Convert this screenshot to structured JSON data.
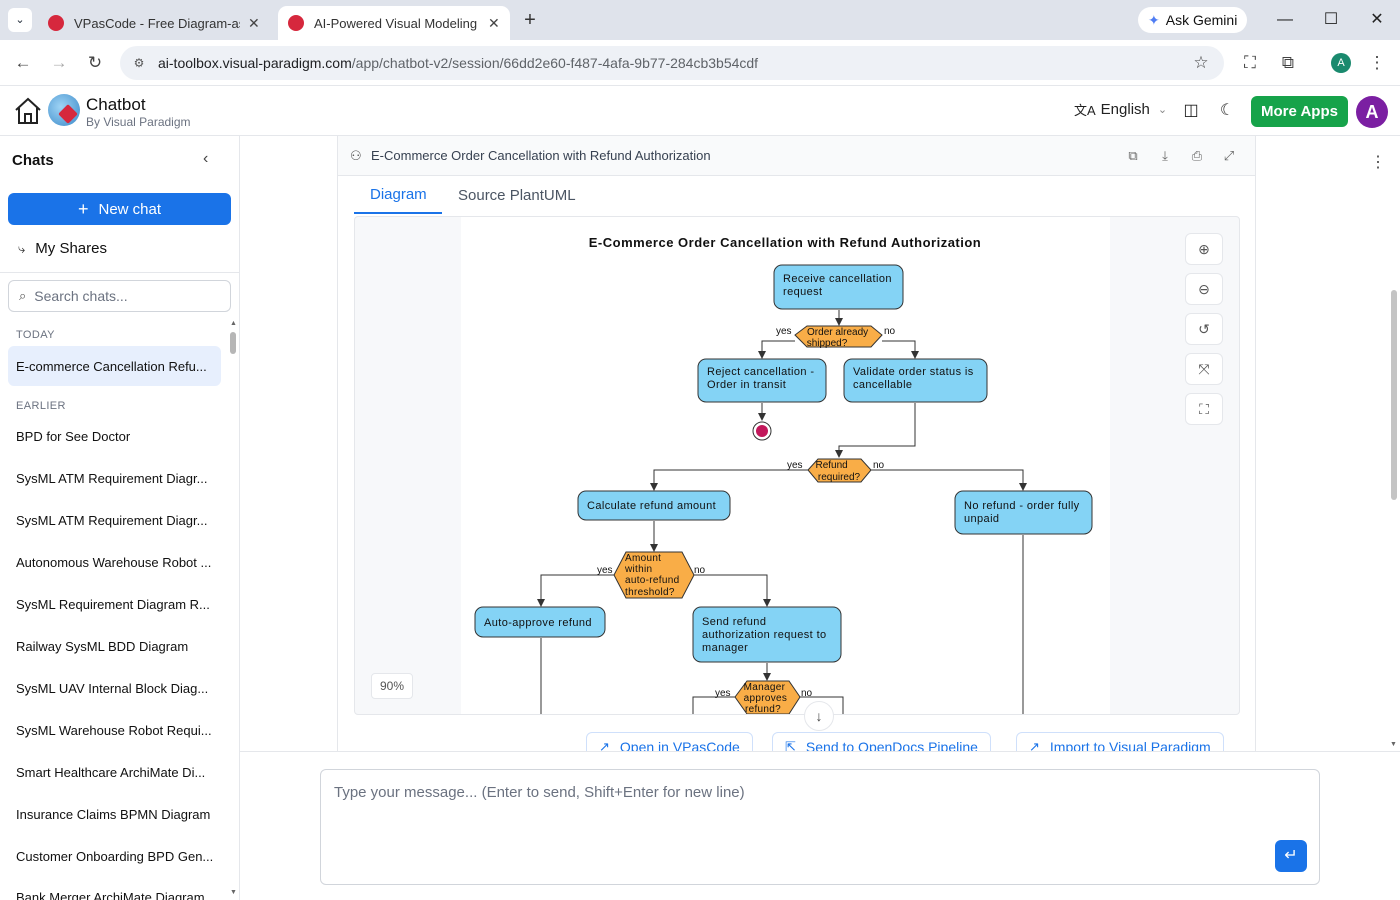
{
  "browser": {
    "tabs": [
      {
        "title": "VPasCode - Free Diagram-as-Code",
        "favicon_color": "#d6283d"
      },
      {
        "title": "AI-Powered Visual Modeling Chatbot",
        "favicon_color": "#d6283d"
      }
    ],
    "ask_gemini": "Ask Gemini",
    "url_host": "ai-toolbox.visual-paradigm.com",
    "url_path": "/app/chatbot-v2/session/66dd2e60-f487-4afa-9b77-284cb3b54cdf",
    "profile_initial": "A"
  },
  "header": {
    "title": "Chatbot",
    "subtitle": "By Visual Paradigm",
    "language": "English",
    "more_apps": "More Apps",
    "user_initial": "A"
  },
  "sidebar": {
    "title": "Chats",
    "new_chat": "New chat",
    "my_shares": "My Shares",
    "search_placeholder": "Search chats...",
    "today_label": "TODAY",
    "earlier_label": "EARLIER",
    "today_items": [
      "E-commerce Cancellation Refu..."
    ],
    "earlier_items": [
      "BPD for See Doctor",
      "SysML ATM Requirement Diagr...",
      "SysML ATM Requirement Diagr...",
      "Autonomous Warehouse Robot ...",
      "SysML Requirement Diagram R...",
      "Railway SysML BDD Diagram",
      "SysML UAV Internal Block Diag...",
      "SysML Warehouse Robot Requi...",
      "Smart Healthcare ArchiMate Di...",
      "Insurance Claims BPMN Diagram",
      "Customer Onboarding BPD Gen...",
      "Bank Merger ArchiMate Diagram"
    ]
  },
  "card": {
    "title": "E-Commerce Order Cancellation with Refund Authorization",
    "tabs": [
      "Diagram",
      "Source PlantUML"
    ],
    "zoom": "90%",
    "actions": [
      "Open in VPasCode",
      "Send to OpenDocs Pipeline",
      "Import to Visual Paradigm"
    ]
  },
  "diagram": {
    "title": "E-Commerce Order Cancellation with Refund Authorization",
    "receive": [
      "Receive cancellation",
      "request"
    ],
    "shipped_q": [
      "Order already",
      "shipped?"
    ],
    "reject": [
      "Reject cancellation -",
      "Order in transit"
    ],
    "validate": [
      "Validate order status is",
      "cancellable"
    ],
    "refund_q": [
      "Refund",
      "required?"
    ],
    "calc": "Calculate refund amount",
    "no_refund": [
      "No refund - order fully",
      "unpaid"
    ],
    "threshold_q": [
      "Amount",
      "within",
      "auto-refund",
      "threshold?"
    ],
    "auto": "Auto-approve refund",
    "send": [
      "Send refund",
      "authorization request to",
      "manager"
    ],
    "manager_q": [
      "Manager",
      "approves",
      "refund?"
    ],
    "yes": "yes",
    "no": "no",
    "colors": {
      "activity": "#84d3f5",
      "decision": "#f9ad47",
      "stop": "#c2185b"
    }
  },
  "composer": {
    "placeholder": "Type your message... (Enter to send, Shift+Enter for new line)"
  }
}
